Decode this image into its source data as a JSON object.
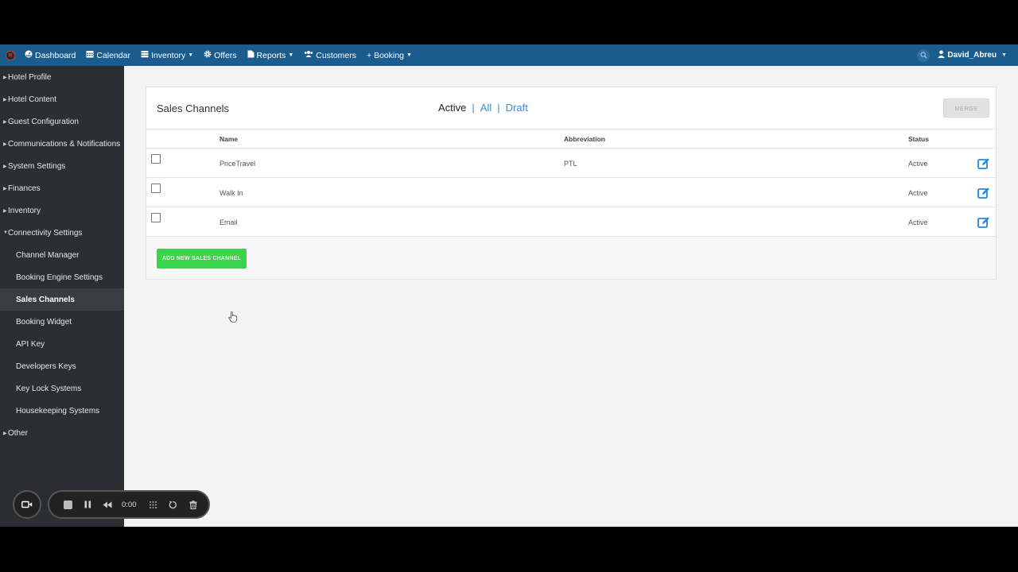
{
  "nav": {
    "logo_text": "IX",
    "items": [
      {
        "label": "Dashboard",
        "icon": "dashboard-icon",
        "has_caret": false
      },
      {
        "label": "Calendar",
        "icon": "calendar-icon",
        "has_caret": false
      },
      {
        "label": "Inventory",
        "icon": "inventory-icon",
        "has_caret": true
      },
      {
        "label": "Offers",
        "icon": "gear-icon",
        "has_caret": false
      },
      {
        "label": "Reports",
        "icon": "file-icon",
        "has_caret": true
      },
      {
        "label": "Customers",
        "icon": "users-icon",
        "has_caret": false
      },
      {
        "label": "+ Booking",
        "icon": "",
        "has_caret": true
      }
    ],
    "user": "David_Abreu"
  },
  "sidebar": {
    "items": [
      {
        "label": "Hotel Profile",
        "expanded": false
      },
      {
        "label": "Hotel Content",
        "expanded": false
      },
      {
        "label": "Guest Configuration",
        "expanded": false
      },
      {
        "label": "Communications & Notifications",
        "expanded": false
      },
      {
        "label": "System Settings",
        "expanded": false
      },
      {
        "label": "Finances",
        "expanded": false
      },
      {
        "label": "Inventory",
        "expanded": false
      },
      {
        "label": "Connectivity Settings",
        "expanded": true
      }
    ],
    "subitems": [
      {
        "label": "Channel Manager",
        "active": false
      },
      {
        "label": "Booking Engine Settings",
        "active": false
      },
      {
        "label": "Sales Channels",
        "active": true
      },
      {
        "label": "Booking Widget",
        "active": false
      },
      {
        "label": "API Key",
        "active": false
      },
      {
        "label": "Developers Keys",
        "active": false
      },
      {
        "label": "Key Lock Systems",
        "active": false
      },
      {
        "label": "Housekeeping Systems",
        "active": false
      }
    ],
    "after": [
      {
        "label": "Other",
        "expanded": false
      }
    ]
  },
  "panel": {
    "title": "Sales Channels",
    "filter_active": "Active",
    "filter_all": "All",
    "filter_draft": "Draft",
    "separator": "|",
    "merge_label": "MERGE",
    "columns": {
      "name": "Name",
      "abbreviation": "Abbreviation",
      "status": "Status"
    },
    "rows": [
      {
        "name": "PriceTravel",
        "abbreviation": "PTL",
        "status": "Active"
      },
      {
        "name": "Walk In",
        "abbreviation": "",
        "status": "Active"
      },
      {
        "name": "Email",
        "abbreviation": "",
        "status": "Active"
      }
    ],
    "add_label": "ADD NEW SALES CHANNEL"
  },
  "recorder": {
    "timer": "0:00"
  },
  "colors": {
    "nav_bg": "#1b5c8f",
    "sidebar_bg": "#2b2f33",
    "link": "#3a8fd8",
    "add_btn": "#39d44d"
  }
}
